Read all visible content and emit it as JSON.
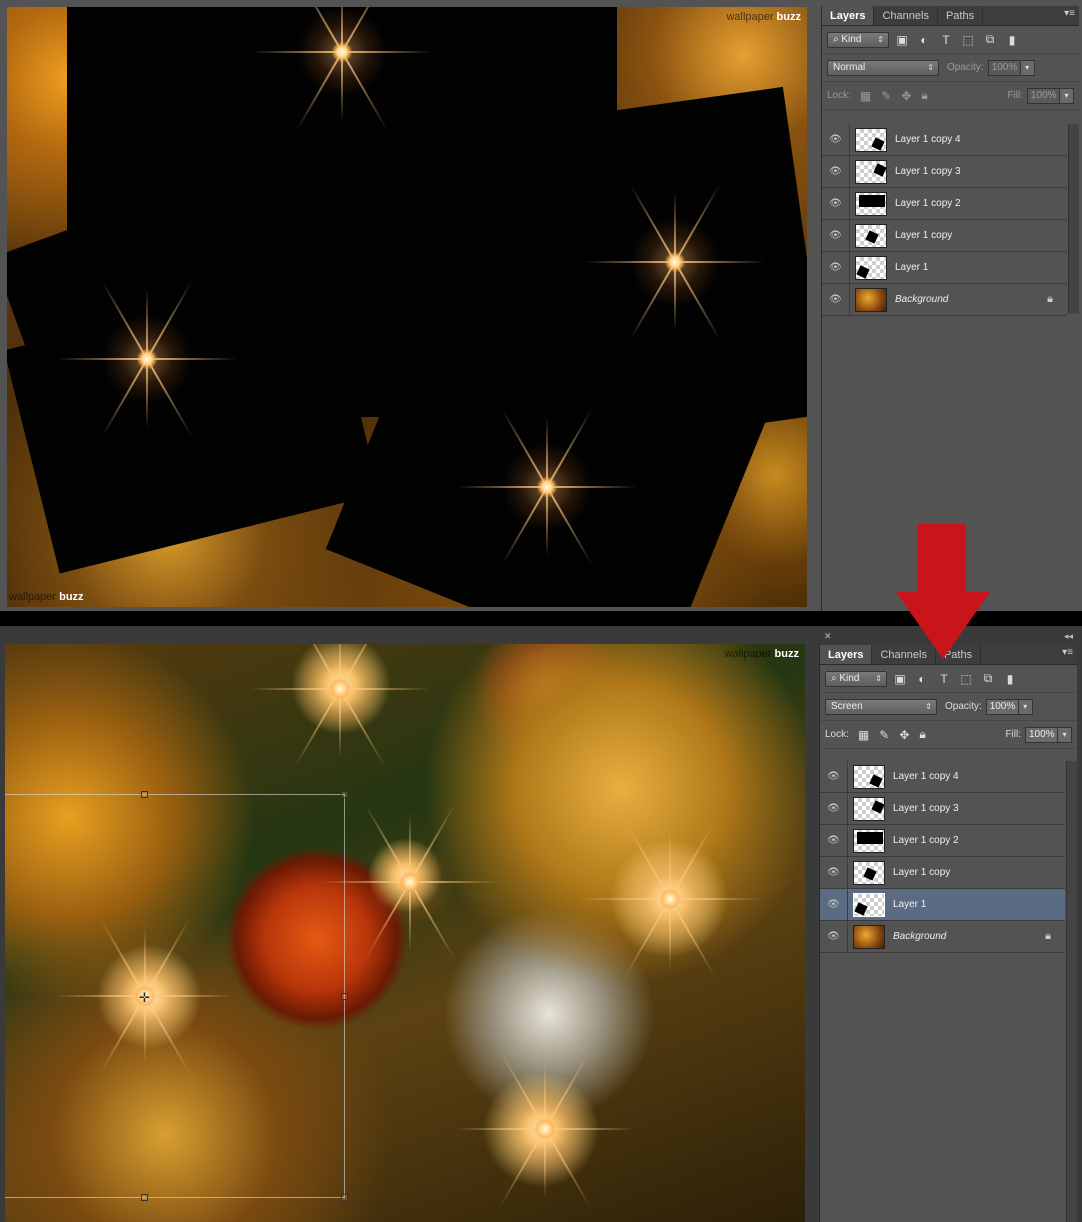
{
  "watermark": {
    "faint": "wallpaper",
    "bold": "buzz"
  },
  "panel": {
    "tabs": [
      "Layers",
      "Channels",
      "Paths"
    ],
    "kind_label": "Kind",
    "opacity_label": "Opacity:",
    "lock_label": "Lock:",
    "fill_label": "Fill:",
    "layers": [
      "Layer 1 copy 4",
      "Layer 1 copy 3",
      "Layer 1 copy 2",
      "Layer 1 copy",
      "Layer 1",
      "Background"
    ]
  },
  "top": {
    "blend_mode": "Normal",
    "opacity": "100%",
    "fill": "100%",
    "selected_layer": "none"
  },
  "bottom": {
    "blend_mode": "Screen",
    "opacity": "100%",
    "fill": "100%",
    "selected_layer": "Layer 1"
  },
  "icons": {
    "visibility": "eye-icon",
    "search": "magnifier-icon",
    "lock": "padlock-icon",
    "arrow": "down-arrow-icon"
  },
  "colors": {
    "arrow": "#c8141a",
    "selected_layer": "#5b6b83"
  }
}
